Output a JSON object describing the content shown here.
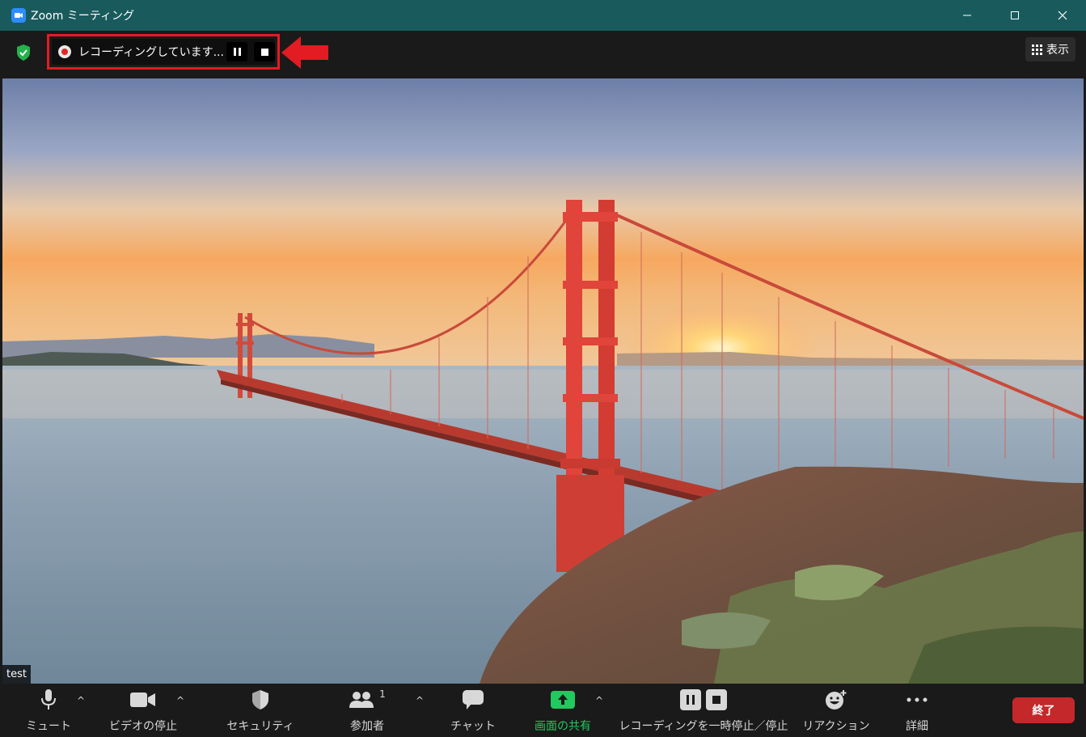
{
  "window": {
    "title": "Zoom ミーティング",
    "controls": {
      "minimize": "—",
      "maximize": "☐",
      "close": "✕"
    }
  },
  "topbar": {
    "recording_status": "レコーディングしています...",
    "view_label": "表示"
  },
  "video": {
    "participant_name": "test"
  },
  "toolbar": {
    "mute_label": "ミュート",
    "video_label": "ビデオの停止",
    "security_label": "セキュリティ",
    "participants_label": "参加者",
    "participants_count": "1",
    "chat_label": "チャット",
    "share_label": "画面の共有",
    "recording_label": "レコーディングを一時停止／停止",
    "reactions_label": "リアクション",
    "more_label": "詳細",
    "end_label": "終了",
    "caret": "^"
  },
  "colors": {
    "titlebar": "#195b5d",
    "highlight": "#e31b23",
    "share_green": "#21c95e",
    "end_red": "#c5282a"
  }
}
